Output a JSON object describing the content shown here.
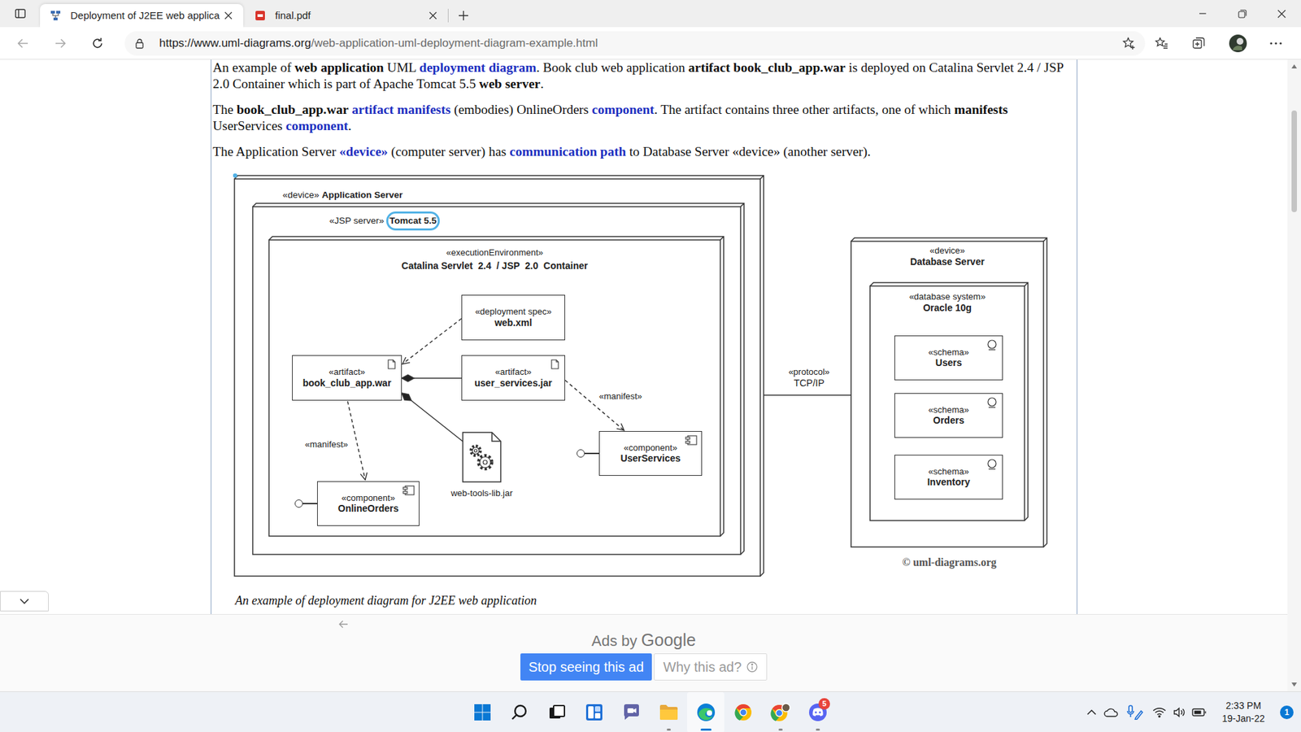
{
  "browser": {
    "tabs": [
      {
        "label": "Deployment of J2EE web applica",
        "selected": true
      },
      {
        "label": "final.pdf",
        "selected": false
      }
    ],
    "back_enabled": false,
    "forward_enabled": false,
    "url_host": "https://www.uml-diagrams.org",
    "url_path": "/web-application-uml-deployment-diagram-example.html"
  },
  "page": {
    "paragraphs": [
      [
        {
          "text": "An example of ",
          "kind": "plain"
        },
        {
          "text": "web application",
          "kind": "bold"
        },
        {
          "text": " UML ",
          "kind": "plain"
        },
        {
          "text": "deployment diagram",
          "kind": "link"
        },
        {
          "text": ". Book club web application ",
          "kind": "plain"
        },
        {
          "text": "artifact book_club_app.war",
          "kind": "bold"
        },
        {
          "text": " is deployed on Catalina Servlet 2.4 / JSP 2.0 Container which is part of Apache Tomcat 5.5 ",
          "kind": "plain"
        },
        {
          "text": "web server",
          "kind": "bold"
        },
        {
          "text": ".",
          "kind": "plain"
        }
      ],
      [
        {
          "text": "The ",
          "kind": "plain"
        },
        {
          "text": "book_club_app.war",
          "kind": "bold"
        },
        {
          "text": " ",
          "kind": "plain"
        },
        {
          "text": "artifact manifests",
          "kind": "link"
        },
        {
          "text": " (embodies) OnlineOrders ",
          "kind": "plain"
        },
        {
          "text": "component",
          "kind": "link"
        },
        {
          "text": ". The artifact contains three other artifacts, one of which ",
          "kind": "plain"
        },
        {
          "text": "manifests",
          "kind": "bold"
        },
        {
          "text": " UserServices ",
          "kind": "plain"
        },
        {
          "text": "component",
          "kind": "link"
        },
        {
          "text": ".",
          "kind": "plain"
        }
      ],
      [
        {
          "text": "The Application Server ",
          "kind": "plain"
        },
        {
          "text": "«device»",
          "kind": "link"
        },
        {
          "text": " (computer server) has ",
          "kind": "plain"
        },
        {
          "text": "communication path",
          "kind": "link"
        },
        {
          "text": " to Database Server «device» (another server).",
          "kind": "plain"
        }
      ]
    ],
    "caption": "An example of deployment diagram for J2EE web application"
  },
  "diagram": {
    "app_server": {
      "stereotype": "«device»",
      "name": "Application Server"
    },
    "web_server": {
      "stereotype": "«JSP server»",
      "name": "Tomcat 5.5",
      "name_highlighted": true
    },
    "container": {
      "stereotype": "«executionEnvironment»",
      "name_parts": [
        {
          "text": "Catalina Servlet ",
          "highlighted": false
        },
        {
          "text": "2.4",
          "highlighted": true
        },
        {
          "text": " / JSP ",
          "highlighted": false
        },
        {
          "text": "2.0",
          "highlighted": true
        },
        {
          "text": " Container",
          "highlighted": false
        }
      ]
    },
    "db_server": {
      "stereotype": "«device»",
      "name": "Database Server"
    },
    "db_system": {
      "stereotype": "«database system»",
      "name": "Oracle 10g"
    },
    "elements": [
      {
        "kind": "spec",
        "stereotype": "«deployment spec»",
        "name": "web.xml"
      },
      {
        "kind": "artifact",
        "stereotype": "«artifact»",
        "name": "book_club_app.war"
      },
      {
        "kind": "artifact",
        "stereotype": "«artifact»",
        "name": "user_services.jar"
      },
      {
        "kind": "library",
        "name": "web-tools-lib.jar"
      },
      {
        "kind": "component",
        "stereotype": "«component»",
        "name": "UserServices"
      },
      {
        "kind": "component",
        "stereotype": "«component»",
        "name": "OnlineOrders"
      },
      {
        "kind": "schema",
        "stereotype": "«schema»",
        "name": "Users"
      },
      {
        "kind": "schema",
        "stereotype": "«schema»",
        "name": "Orders"
      },
      {
        "kind": "schema",
        "stereotype": "«schema»",
        "name": "Inventory"
      }
    ],
    "labels": [
      "«manifest»",
      "«manifest»"
    ],
    "protocol": {
      "stereotype": "«protocol»",
      "name": "TCP/IP"
    },
    "copyright": "© uml-diagrams.org"
  },
  "ad": {
    "attribution_prefix": "Ads by",
    "attribution_brand": "Google",
    "buttons": [
      {
        "label": "Stop seeing this ad",
        "kind": "primary"
      },
      {
        "label": "Why this ad?",
        "kind": "secondary"
      }
    ]
  },
  "taskbar": {
    "time": "2:33 PM",
    "date": "19-Jan-22",
    "notification_count": "1",
    "discord_badge": "5"
  }
}
